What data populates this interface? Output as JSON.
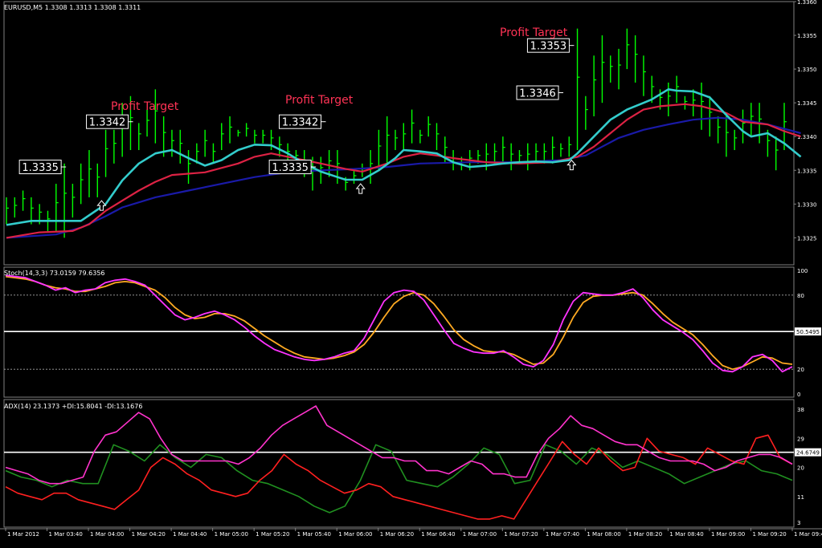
{
  "colors": {
    "background": "#000000",
    "grid": "#808080",
    "bar": "#00ff00",
    "ma_fast": "#33cccc",
    "ma_mid": "#dd2244",
    "ma_slow": "#1a1aa8",
    "stoch_main": "#ff33ff",
    "stoch_signal": "#ffaa22",
    "adx": "#ff33cc",
    "plus_di": "#ff2020",
    "minus_di": "#209020",
    "label_text": "#ffffff",
    "profit_text": "#ff3355"
  },
  "chart_data": [
    {
      "type": "line",
      "title": "EURUSD,M5",
      "ohlc_header": "1.3308 1.3313 1.3308 1.3311",
      "ylim": [
        1.3321,
        1.336
      ],
      "yticks": [
        "1.3360",
        "1.3355",
        "1.3350",
        "1.3345",
        "1.3340",
        "1.3335",
        "1.3330",
        "1.3325"
      ],
      "bars": [
        [
          1.3327,
          1.3331
        ],
        [
          1.3328,
          1.3331
        ],
        [
          1.3329,
          1.3332
        ],
        [
          1.3327,
          1.3331
        ],
        [
          1.3327,
          1.333
        ],
        [
          1.3326,
          1.3329
        ],
        [
          1.3326,
          1.3333
        ],
        [
          1.3325,
          1.3336
        ],
        [
          1.3328,
          1.3333
        ],
        [
          1.333,
          1.3336
        ],
        [
          1.3331,
          1.3338
        ],
        [
          1.3331,
          1.3336
        ],
        [
          1.3334,
          1.3341
        ],
        [
          1.3336,
          1.3341
        ],
        [
          1.3337,
          1.3345
        ],
        [
          1.3338,
          1.3346
        ],
        [
          1.3338,
          1.3342
        ],
        [
          1.334,
          1.3344
        ],
        [
          1.3339,
          1.3347
        ],
        [
          1.3337,
          1.3343
        ],
        [
          1.3337,
          1.3341
        ],
        [
          1.3336,
          1.3341
        ],
        [
          1.3333,
          1.3338
        ],
        [
          1.3336,
          1.3339
        ],
        [
          1.3337,
          1.3341
        ],
        [
          1.3336,
          1.3339
        ],
        [
          1.3338,
          1.3342
        ],
        [
          1.3339,
          1.3343
        ],
        [
          1.334,
          1.3341
        ],
        [
          1.334,
          1.3342
        ],
        [
          1.3339,
          1.3341
        ],
        [
          1.3339,
          1.3341
        ],
        [
          1.3338,
          1.3341
        ],
        [
          1.3337,
          1.334
        ],
        [
          1.3336,
          1.3339
        ],
        [
          1.3336,
          1.3338
        ],
        [
          1.3334,
          1.3338
        ],
        [
          1.3332,
          1.3337
        ],
        [
          1.3333,
          1.3337
        ],
        [
          1.3334,
          1.3338
        ],
        [
          1.3333,
          1.3338
        ],
        [
          1.3332,
          1.3334
        ],
        [
          1.3333,
          1.3335
        ],
        [
          1.3334,
          1.3336
        ],
        [
          1.3333,
          1.3338
        ],
        [
          1.3335,
          1.3341
        ],
        [
          1.3336,
          1.3343
        ],
        [
          1.3338,
          1.3341
        ],
        [
          1.3338,
          1.3342
        ],
        [
          1.3339,
          1.3344
        ],
        [
          1.3339,
          1.3341
        ],
        [
          1.334,
          1.3343
        ],
        [
          1.3338,
          1.3342
        ],
        [
          1.3336,
          1.334
        ],
        [
          1.3335,
          1.3338
        ],
        [
          1.3335,
          1.3337
        ],
        [
          1.3335,
          1.3338
        ],
        [
          1.3336,
          1.3338
        ],
        [
          1.3335,
          1.3339
        ],
        [
          1.3336,
          1.3339
        ],
        [
          1.3336,
          1.334
        ],
        [
          1.3335,
          1.3339
        ],
        [
          1.3336,
          1.3338
        ],
        [
          1.3335,
          1.3339
        ],
        [
          1.3336,
          1.3339
        ],
        [
          1.3336,
          1.3339
        ],
        [
          1.3336,
          1.334
        ],
        [
          1.3337,
          1.3339
        ],
        [
          1.3337,
          1.334
        ],
        [
          1.3338,
          1.3356
        ],
        [
          1.3341,
          1.3346
        ],
        [
          1.3343,
          1.3352
        ],
        [
          1.3345,
          1.3355
        ],
        [
          1.3348,
          1.3352
        ],
        [
          1.3347,
          1.3353
        ],
        [
          1.335,
          1.3356
        ],
        [
          1.3348,
          1.3355
        ],
        [
          1.3346,
          1.3352
        ],
        [
          1.3345,
          1.3349
        ],
        [
          1.3344,
          1.3347
        ],
        [
          1.3343,
          1.3348
        ],
        [
          1.3345,
          1.3349
        ],
        [
          1.3344,
          1.3346
        ],
        [
          1.3343,
          1.3347
        ],
        [
          1.3341,
          1.3348
        ],
        [
          1.334,
          1.3346
        ],
        [
          1.3339,
          1.3343
        ],
        [
          1.3337,
          1.3343
        ],
        [
          1.3338,
          1.3341
        ],
        [
          1.3339,
          1.3344
        ],
        [
          1.334,
          1.3345
        ],
        [
          1.3339,
          1.3345
        ],
        [
          1.3337,
          1.3341
        ],
        [
          1.3335,
          1.334
        ],
        [
          1.3338,
          1.3345
        ]
      ],
      "ma_fast": [
        [
          0,
          1.33269
        ],
        [
          3,
          1.33275
        ],
        [
          6,
          1.33275
        ],
        [
          9,
          1.33275
        ],
        [
          12,
          1.333
        ],
        [
          14,
          1.33335
        ],
        [
          16,
          1.3336
        ],
        [
          18,
          1.33375
        ],
        [
          20,
          1.3338
        ],
        [
          22,
          1.33368
        ],
        [
          24,
          1.33357
        ],
        [
          26,
          1.33365
        ],
        [
          28,
          1.3338
        ],
        [
          30,
          1.33388
        ],
        [
          32,
          1.33387
        ],
        [
          34,
          1.33375
        ],
        [
          36,
          1.3336
        ],
        [
          38,
          1.33348
        ],
        [
          40,
          1.3334
        ],
        [
          41,
          1.33336
        ],
        [
          43,
          1.33336
        ],
        [
          45,
          1.3335
        ],
        [
          47,
          1.33368
        ],
        [
          48,
          1.3338
        ],
        [
          50,
          1.33378
        ],
        [
          52,
          1.33375
        ],
        [
          54,
          1.33362
        ],
        [
          56,
          1.33355
        ],
        [
          58,
          1.33357
        ],
        [
          60,
          1.3336
        ],
        [
          62,
          1.33362
        ],
        [
          64,
          1.33363
        ],
        [
          66,
          1.33362
        ],
        [
          68,
          1.33365
        ],
        [
          69,
          1.33375
        ],
        [
          71,
          1.334
        ],
        [
          73,
          1.33425
        ],
        [
          75,
          1.3344
        ],
        [
          77,
          1.3345
        ],
        [
          78,
          1.33455
        ],
        [
          80,
          1.3347
        ],
        [
          81,
          1.33468
        ],
        [
          83,
          1.33467
        ],
        [
          85,
          1.33458
        ],
        [
          87,
          1.33432
        ],
        [
          89,
          1.33408
        ],
        [
          90,
          1.334
        ],
        [
          92,
          1.33405
        ],
        [
          94,
          1.3339
        ],
        [
          96,
          1.3337
        ]
      ],
      "ma_mid": [
        [
          0,
          1.3325
        ],
        [
          4,
          1.33258
        ],
        [
          8,
          1.3326
        ],
        [
          10,
          1.3327
        ],
        [
          12,
          1.3329
        ],
        [
          14,
          1.33305
        ],
        [
          16,
          1.3332
        ],
        [
          18,
          1.33333
        ],
        [
          20,
          1.33343
        ],
        [
          24,
          1.33347
        ],
        [
          28,
          1.3336
        ],
        [
          30,
          1.3337
        ],
        [
          32,
          1.33375
        ],
        [
          34,
          1.3337
        ],
        [
          36,
          1.33365
        ],
        [
          38,
          1.3336
        ],
        [
          41,
          1.33352
        ],
        [
          43,
          1.33348
        ],
        [
          46,
          1.3336
        ],
        [
          48,
          1.3337
        ],
        [
          50,
          1.33375
        ],
        [
          52,
          1.33372
        ],
        [
          54,
          1.33368
        ],
        [
          58,
          1.33362
        ],
        [
          62,
          1.3336
        ],
        [
          66,
          1.33362
        ],
        [
          69,
          1.3337
        ],
        [
          71,
          1.33385
        ],
        [
          73,
          1.33405
        ],
        [
          75,
          1.33425
        ],
        [
          77,
          1.3344
        ],
        [
          79,
          1.33445
        ],
        [
          82,
          1.33448
        ],
        [
          84,
          1.33445
        ],
        [
          87,
          1.33435
        ],
        [
          89,
          1.33422
        ],
        [
          92,
          1.33418
        ],
        [
          94,
          1.33408
        ],
        [
          96,
          1.334
        ]
      ],
      "ma_slow": [
        [
          0,
          1.3325
        ],
        [
          6,
          1.33255
        ],
        [
          9,
          1.33265
        ],
        [
          12,
          1.33282
        ],
        [
          14,
          1.33295
        ],
        [
          18,
          1.3331
        ],
        [
          22,
          1.3332
        ],
        [
          26,
          1.3333
        ],
        [
          30,
          1.3334
        ],
        [
          34,
          1.33347
        ],
        [
          38,
          1.3335
        ],
        [
          42,
          1.33352
        ],
        [
          46,
          1.33355
        ],
        [
          50,
          1.3336
        ],
        [
          56,
          1.33362
        ],
        [
          62,
          1.33362
        ],
        [
          67,
          1.33365
        ],
        [
          70,
          1.33372
        ],
        [
          72,
          1.33385
        ],
        [
          74,
          1.33398
        ],
        [
          77,
          1.3341
        ],
        [
          80,
          1.33418
        ],
        [
          83,
          1.33425
        ],
        [
          86,
          1.33428
        ],
        [
          89,
          1.33425
        ],
        [
          92,
          1.33418
        ],
        [
          96,
          1.33405
        ]
      ],
      "markers": [
        {
          "label": "1.3335",
          "price": 1.33355,
          "idx": 7.2
        },
        {
          "label": "1.3342",
          "price": 1.33422,
          "idx": 15.3
        },
        {
          "label": "1.3342",
          "price": 1.33422,
          "idx": 38.6
        },
        {
          "label": "1.3335",
          "price": 1.33355,
          "idx": 37.4
        },
        {
          "label": "1.3346",
          "price": 1.33465,
          "idx": 67.3
        },
        {
          "label": "1.3353",
          "price": 1.33535,
          "idx": 68.6
        }
      ],
      "arrows": [
        {
          "idx": 11.5,
          "price": 1.33305
        },
        {
          "idx": 42.8,
          "price": 1.3333
        },
        {
          "idx": 68.3,
          "price": 1.33365
        }
      ],
      "annotations": [
        "Profit Target",
        "Profit Target",
        "Profit Target"
      ]
    },
    {
      "type": "line",
      "title": "Stoch(14,3,3) 73.0159 79.6356",
      "ylim": [
        0,
        100
      ],
      "yticks": [
        "100",
        "80",
        "20",
        "0"
      ],
      "levels": [
        80,
        50.5495,
        20
      ],
      "level_label": "50.5495",
      "main": [
        96,
        95,
        94,
        91,
        88,
        84,
        86,
        82,
        84,
        85,
        90,
        92,
        93,
        91,
        88,
        80,
        72,
        64,
        60,
        62,
        65,
        67,
        64,
        60,
        54,
        47,
        41,
        36,
        33,
        30,
        28,
        27,
        28,
        30,
        33,
        35,
        45,
        60,
        75,
        82,
        84,
        83,
        76,
        64,
        52,
        41,
        37,
        34,
        33,
        33,
        35,
        30,
        24,
        22,
        27,
        40,
        60,
        75,
        82,
        81,
        80,
        80,
        82,
        85,
        78,
        68,
        60,
        55,
        50,
        44,
        35,
        25,
        19,
        18,
        22,
        30,
        32,
        27,
        18,
        22
      ],
      "signal": [
        95,
        94,
        93,
        91,
        88,
        86,
        85,
        83,
        83,
        85,
        87,
        90,
        91,
        90,
        87,
        84,
        78,
        70,
        64,
        61,
        62,
        65,
        65,
        63,
        59,
        53,
        47,
        42,
        37,
        33,
        30,
        29,
        28,
        29,
        31,
        34,
        40,
        50,
        62,
        73,
        79,
        82,
        80,
        73,
        63,
        52,
        44,
        39,
        35,
        34,
        34,
        32,
        28,
        24,
        25,
        32,
        46,
        62,
        74,
        79,
        80,
        80,
        81,
        82,
        80,
        73,
        65,
        58,
        53,
        48,
        40,
        31,
        23,
        20,
        22,
        26,
        30,
        29,
        25,
        24
      ]
    },
    {
      "type": "line",
      "title": "ADX(14) 23.1373 +DI:15.8041 -DI:13.1676",
      "ylim": [
        2,
        40
      ],
      "yticks": [
        "38",
        "29",
        "20",
        "11",
        "3"
      ],
      "level": 24.6749,
      "level_label": "24.6749",
      "adx": [
        20,
        19,
        18,
        16,
        15,
        15,
        16,
        17,
        25,
        30,
        31,
        34,
        37,
        35,
        29,
        24,
        22,
        22,
        22,
        22,
        22,
        21,
        23,
        26,
        30,
        33,
        35,
        37,
        39,
        33,
        31,
        29,
        27,
        25,
        23,
        23,
        22,
        22,
        19,
        19,
        18,
        20,
        22,
        21,
        18,
        18,
        17,
        17,
        24,
        29,
        32,
        36,
        33,
        32,
        30,
        28,
        27,
        27,
        25,
        23,
        22,
        22,
        22,
        21,
        19,
        20,
        22,
        23,
        24,
        24,
        23,
        21
      ],
      "plus_di": [
        14,
        12,
        11,
        10,
        12,
        12,
        10,
        9,
        8,
        7,
        10,
        13,
        20,
        23,
        21,
        18,
        16,
        13,
        12,
        11,
        12,
        16,
        19,
        24,
        21,
        19,
        16,
        14,
        12,
        13,
        15,
        14,
        11,
        10,
        9,
        8,
        7,
        6,
        5,
        4,
        4,
        5,
        4,
        10,
        16,
        22,
        28,
        24,
        21,
        26,
        22,
        19,
        20,
        29,
        25,
        24,
        23,
        21,
        26,
        24,
        22,
        21,
        29,
        30,
        23,
        21
      ],
      "minus_di": [
        19,
        17,
        16,
        14,
        16,
        15,
        15,
        27,
        25,
        22,
        27,
        23,
        20,
        24,
        23,
        19,
        16,
        15,
        13,
        11,
        8,
        6,
        8,
        16,
        27,
        25,
        16,
        15,
        14,
        17,
        21,
        26,
        24,
        15,
        16,
        27,
        25,
        21,
        26,
        24,
        20,
        22,
        20,
        18,
        15,
        17,
        19,
        21,
        22,
        19,
        18,
        16
      ]
    }
  ],
  "xaxis": {
    "labels": [
      "1 Mar 2012",
      "1 Mar 03:40",
      "1 Mar 04:00",
      "1 Mar 04:20",
      "1 Mar 04:40",
      "1 Mar 05:00",
      "1 Mar 05:20",
      "1 Mar 05:40",
      "1 Mar 06:00",
      "1 Mar 06:20",
      "1 Mar 06:40",
      "1 Mar 07:00",
      "1 Mar 07:20",
      "1 Mar 07:40",
      "1 Mar 08:00",
      "1 Mar 08:20",
      "1 Mar 08:40",
      "1 Mar 09:00",
      "1 Mar 09:20",
      "1 Mar 09:40"
    ]
  }
}
